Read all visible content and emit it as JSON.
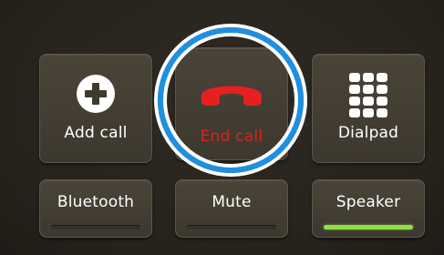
{
  "buttons": {
    "add_call": {
      "label": "Add call",
      "icon": "plus-circle-icon"
    },
    "end_call": {
      "label": "End call",
      "icon": "phone-hangup-icon",
      "color": "#e02020"
    },
    "dialpad": {
      "label": "Dialpad",
      "icon": "dialpad-grid-icon"
    },
    "bluetooth": {
      "label": "Bluetooth",
      "active": false
    },
    "mute": {
      "label": "Mute",
      "active": false
    },
    "speaker": {
      "label": "Speaker",
      "active": true
    }
  },
  "colors": {
    "focus_ring": "#1f8fe0",
    "active_indicator": "#8ee04a",
    "end_call_red": "#e02020"
  }
}
